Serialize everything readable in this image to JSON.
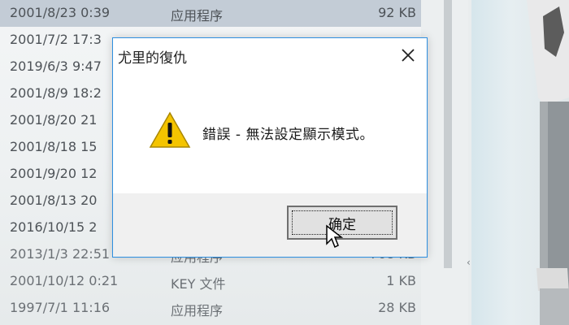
{
  "file_list": {
    "rows": [
      {
        "date": "2001/8/23 0:39",
        "type": "应用程序",
        "size": "92 KB",
        "selected": true
      },
      {
        "date": "2001/7/2 17:3",
        "type": "",
        "size": ""
      },
      {
        "date": "2019/6/3 9:47",
        "type": "",
        "size": ""
      },
      {
        "date": "2001/8/9 18:2",
        "type": "",
        "size": ""
      },
      {
        "date": "2001/8/20 21",
        "type": "",
        "size": ""
      },
      {
        "date": "2001/8/18 15",
        "type": "",
        "size": ""
      },
      {
        "date": "2001/9/20 12",
        "type": "",
        "size": ""
      },
      {
        "date": "2001/8/13 20",
        "type": "",
        "size": ""
      },
      {
        "date": "2016/10/15 2",
        "type": "",
        "size": ""
      },
      {
        "date": "2013/1/3 22:51",
        "type": "应用程序",
        "size": "708 KB"
      },
      {
        "date": "2001/10/12 0:21",
        "type": "KEY 文件",
        "size": "1 KB"
      },
      {
        "date": "1997/7/1 11:16",
        "type": "应用程序",
        "size": "28 KB"
      }
    ]
  },
  "dialog": {
    "title": "尤里的復仇",
    "message": "錯誤 - 無法設定顯示模式。",
    "ok_label": "确定",
    "icon": "warning-icon"
  },
  "colors": {
    "accent_border": "#2e8fe0",
    "warning_yellow": "#f4c400"
  }
}
